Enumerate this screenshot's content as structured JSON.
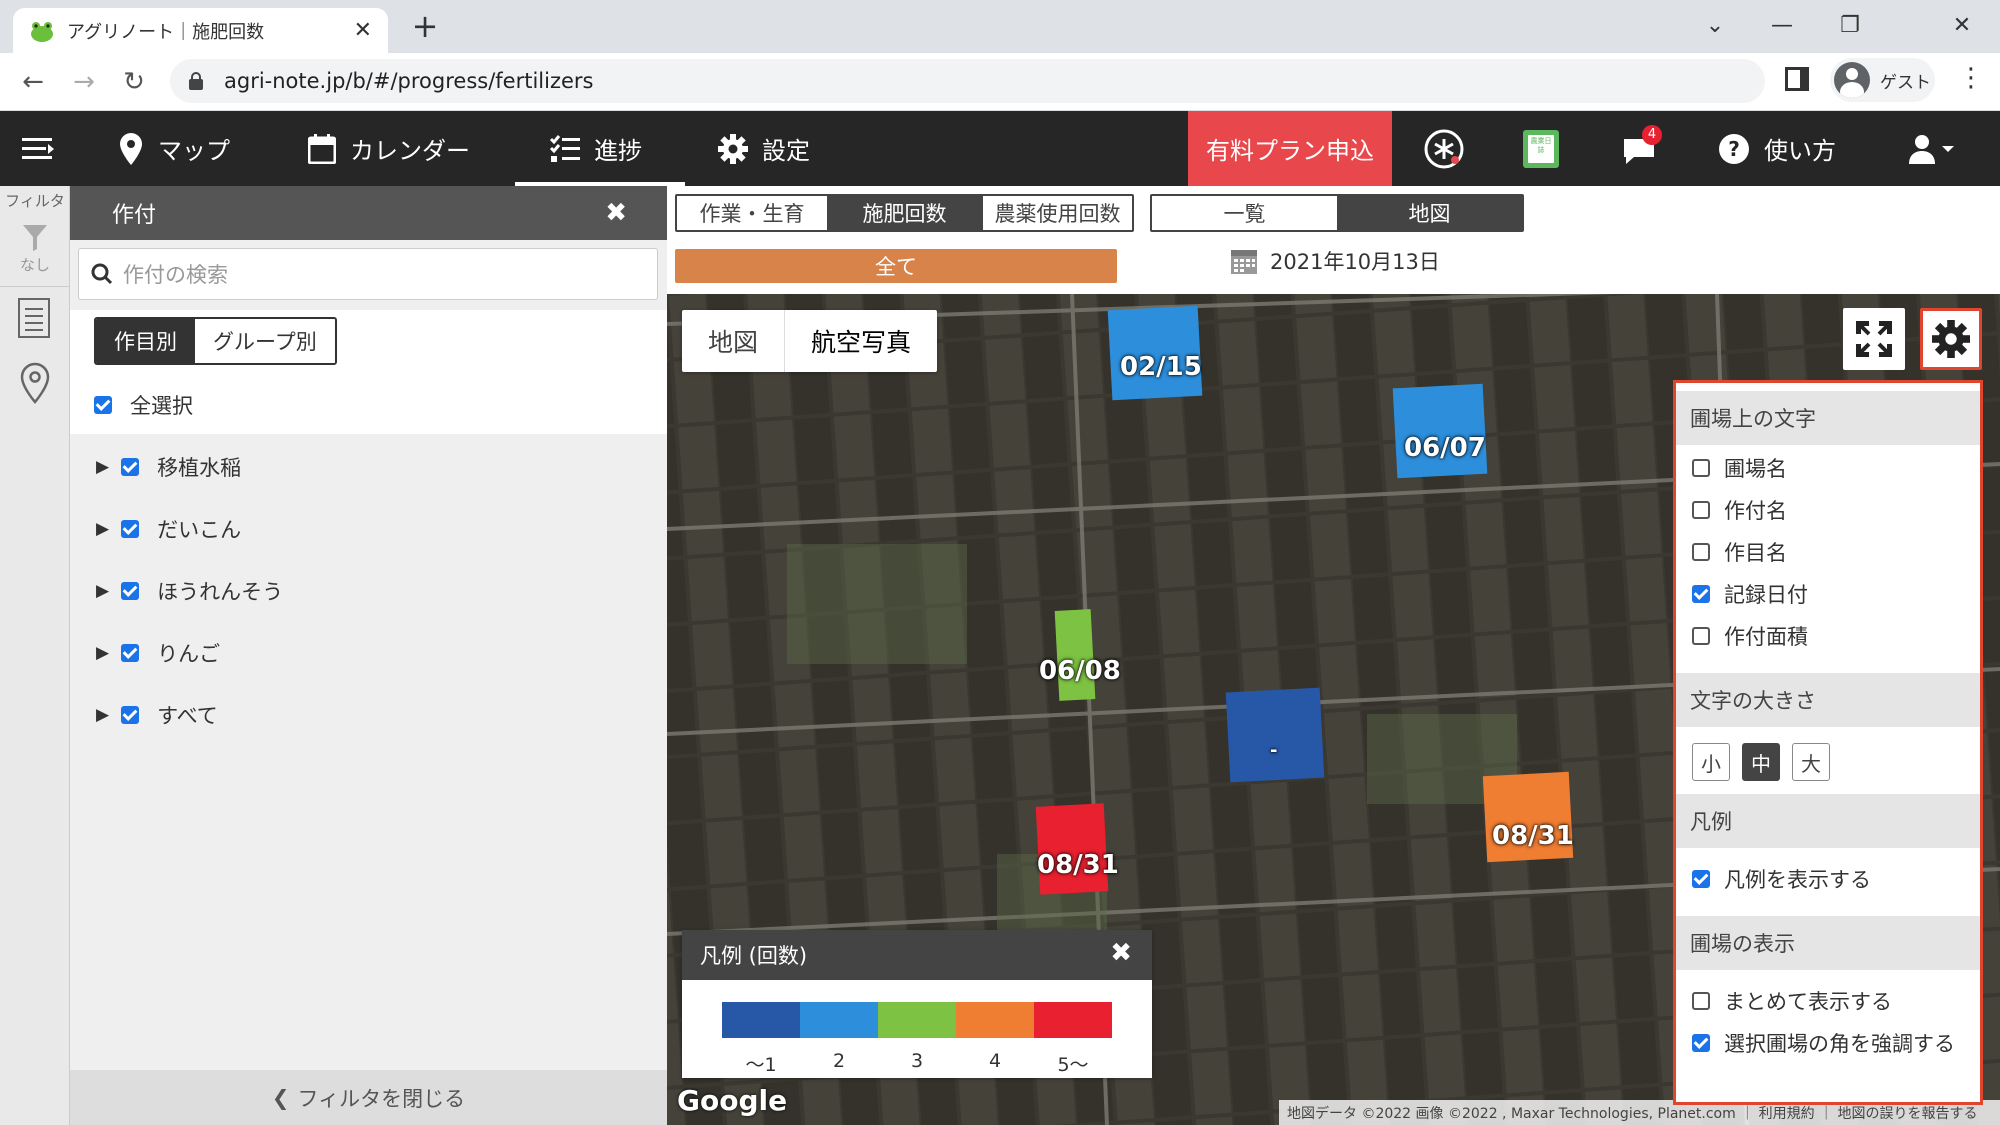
{
  "browser": {
    "tab_title": "アグリノート｜施肥回数",
    "url": "agri-note.jp/b/#/progress/fertilizers",
    "profile_label": "ゲスト"
  },
  "app_header": {
    "nav": [
      {
        "label": "マップ",
        "icon": "map-pin-icon"
      },
      {
        "label": "カレンダー",
        "icon": "calendar-icon"
      },
      {
        "label": "進捗",
        "icon": "checklist-icon",
        "active": true
      },
      {
        "label": "設定",
        "icon": "gear-icon"
      }
    ],
    "paid_plan_label": "有料プラン申込",
    "notification_count": "4",
    "help_label": "使い方",
    "notebook_icon_text": "農業日誌"
  },
  "rail": {
    "filter_label": "フィルタ",
    "filter_state": "なし"
  },
  "filter_panel": {
    "title": "作付",
    "search_placeholder": "作付の検索",
    "group_tabs": [
      "作目別",
      "グループ別"
    ],
    "select_all_label": "全選択",
    "items": [
      "移植水稲",
      "だいこん",
      "ほうれんそう",
      "りんご",
      "すべて"
    ],
    "close_label": "フィルタを閉じる"
  },
  "toolbar": {
    "mode_tabs": [
      "作業・生育",
      "施肥回数",
      "農薬使用回数"
    ],
    "active_mode": "施肥回数",
    "view_tabs": [
      "一覧",
      "地図"
    ],
    "active_view": "地図",
    "all_label": "全て",
    "date": "2021年10月13日"
  },
  "map": {
    "type_tabs": [
      "地図",
      "航空写真"
    ],
    "active_type": "航空写真",
    "fields": [
      {
        "label": "02/15",
        "color": "#2d8fdc"
      },
      {
        "label": "06/07",
        "color": "#2d8fdc"
      },
      {
        "label": "06/08",
        "color": "#7dc242"
      },
      {
        "label": "-",
        "color": "#2758a8"
      },
      {
        "label": "08/31",
        "color": "#e8202f"
      },
      {
        "label": "08/31",
        "color": "#ef7d32"
      }
    ],
    "legend": {
      "title": "凡例 (回数)",
      "items": [
        {
          "label": "～1",
          "color": "#2758a8"
        },
        {
          "label": "2",
          "color": "#2d8fdc"
        },
        {
          "label": "3",
          "color": "#7dc242"
        },
        {
          "label": "4",
          "color": "#ef7d32"
        },
        {
          "label": "5～",
          "color": "#e8202f"
        }
      ]
    },
    "google_logo": "Google",
    "attribution": "地図データ ©2022 画像 ©2022 , Maxar Technologies, Planet.com ｜ 利用規約 ｜ 地図の誤りを報告する"
  },
  "settings": {
    "section_text": "圃場上の文字",
    "text_options": [
      {
        "label": "圃場名",
        "checked": false
      },
      {
        "label": "作付名",
        "checked": false
      },
      {
        "label": "作目名",
        "checked": false
      },
      {
        "label": "記録日付",
        "checked": true
      },
      {
        "label": "作付面積",
        "checked": false
      }
    ],
    "section_size": "文字の大きさ",
    "sizes": [
      "小",
      "中",
      "大"
    ],
    "active_size": "中",
    "section_legend": "凡例",
    "legend_option": "凡例を表示する",
    "section_display": "圃場の表示",
    "display_options": [
      {
        "label": "まとめて表示する",
        "checked": false
      },
      {
        "label": "選択圃場の角を強調する",
        "checked": true
      }
    ]
  }
}
